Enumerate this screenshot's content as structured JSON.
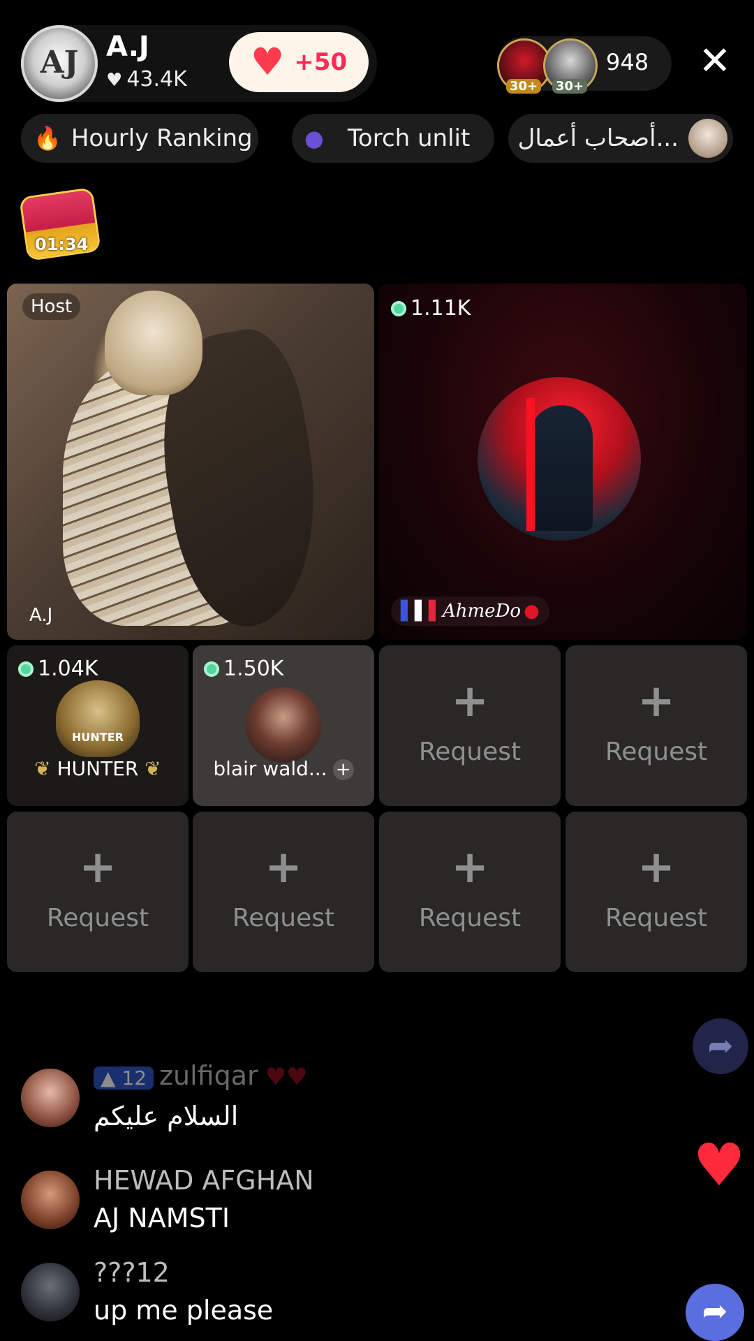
{
  "header": {
    "host_name": "A.J",
    "host_avatar_text": "AJ",
    "host_likes": "43.4K",
    "like_button": "+50",
    "viewers": {
      "badges": [
        "30+",
        "30+"
      ],
      "count": "948"
    },
    "close_icon": "close-icon"
  },
  "pills": {
    "ranking": {
      "label": "Hourly Ranking",
      "icon": "flame-icon"
    },
    "torch": {
      "label": "Torch unlit",
      "icon": "torch-icon"
    },
    "group": {
      "label": "...أصحاب أعمال",
      "icon": "group-avatar"
    }
  },
  "treasure": {
    "timer": "01:34"
  },
  "stage": {
    "host": {
      "tag": "Host",
      "name": "A.J"
    },
    "guest": {
      "coins": "1.11K",
      "name": "AhmeDo"
    },
    "seats": [
      {
        "coins": "1.04K",
        "name": "HUNTER",
        "emblem_text": "HUNTER"
      },
      {
        "coins": "1.50K",
        "name": "blair wald...",
        "add": "+"
      }
    ],
    "request_label": "Request",
    "plus": "+"
  },
  "comments": [
    {
      "level": "12",
      "name": "zulfiqar",
      "text": "السلام عليكم"
    },
    {
      "name": "HEWAD AFGHAN",
      "text": "AJ NAMSTI"
    },
    {
      "name": "???12",
      "text": "up me please"
    }
  ],
  "colors": {
    "accent_red": "#ff2b3d",
    "coin_green": "#55d69c",
    "share_blue": "#5b6ee0"
  }
}
